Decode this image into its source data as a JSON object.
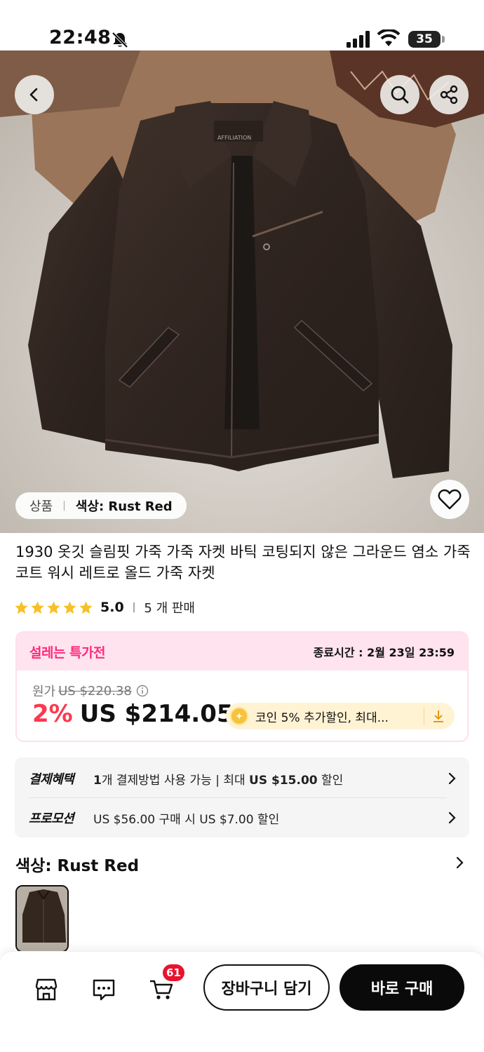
{
  "status_bar": {
    "time": "22:48",
    "battery": "35"
  },
  "product_image": {
    "alt_variant_label": "상품",
    "variant_label": "색상: Rust Red",
    "jacket_label": "AFFILIATION"
  },
  "product": {
    "title": "1930 옷깃 슬림핏 가죽 가죽 자켓 바틱 코팅되지 않은 그라운드 염소 가죽 코트 워시 레트로 올드 가죽 자켓",
    "rating": "5.0",
    "stars": 5,
    "sold": "5 개 판매"
  },
  "deal": {
    "title": "설레는 특가전",
    "end_time": "종료시간 : 2월 23일 23:59",
    "original_label": "원가",
    "original_price": "US $220.38",
    "discount": "2%",
    "price": "US $214.05",
    "coin_text": "코인 5% 추가할인, 최대..."
  },
  "benefits": {
    "payment_label": "결제혜택",
    "payment_text_1": "1",
    "payment_text_2": "개 결제방법 사용 가능 | 최대 ",
    "payment_text_3": "US $15.00",
    "payment_text_4": " 할인",
    "promo_label": "프로모션",
    "promo_text": "US $56.00 구매 시 US $7.00 할인"
  },
  "color_section": {
    "title": "색상: Rust Red"
  },
  "bottom_bar": {
    "cart_count": "61",
    "add_to_cart": "장바구니 담기",
    "buy_now": "바로 구매"
  },
  "colors": {
    "accent_pink": "#ff2a7a",
    "price_red": "#fd384f",
    "star": "#f7c028",
    "buy_bg": "#0a0a0a"
  }
}
